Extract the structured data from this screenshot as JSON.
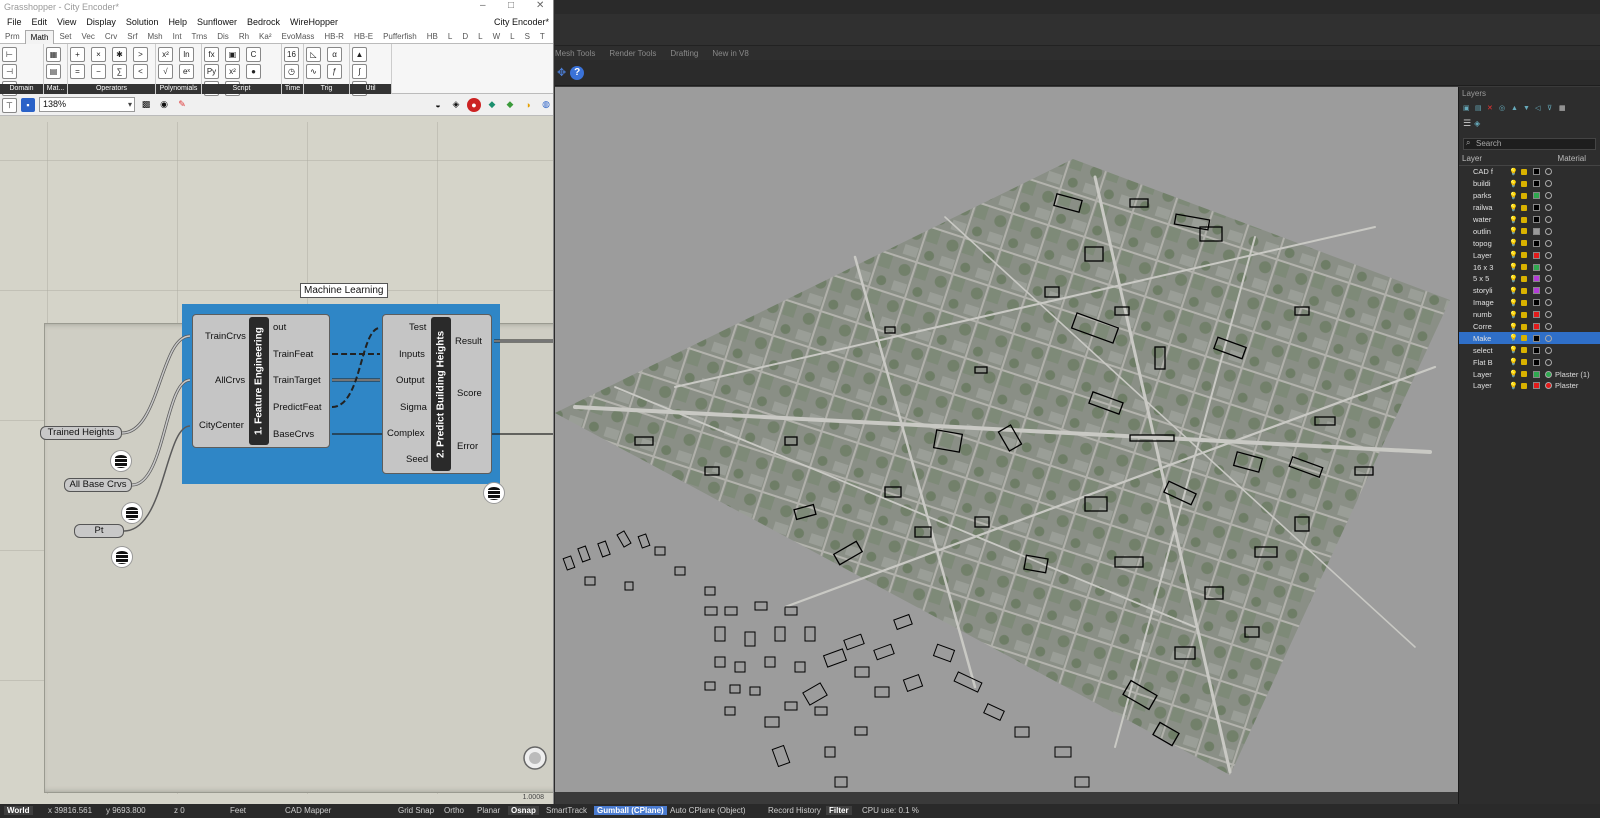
{
  "gh": {
    "title": "Grasshopper - City Encoder*",
    "doc_name": "City Encoder*",
    "menu": [
      "File",
      "Edit",
      "View",
      "Display",
      "Solution",
      "Help",
      "Sunflower",
      "Bedrock",
      "WireHopper"
    ],
    "tabs": [
      "Prm",
      "Math",
      "Set",
      "Vec",
      "Crv",
      "Srf",
      "Msh",
      "Int",
      "Trns",
      "Dis",
      "Rh",
      "Ka²",
      "EvoMass",
      "HB-R",
      "HB-E",
      "Pufferfish",
      "HB",
      "L",
      "D",
      "L",
      "W",
      "L",
      "S",
      "T"
    ],
    "active_tab": "Math",
    "ribbon_groups": [
      "Domain",
      "Mat...",
      "Operators",
      "Polynomials",
      "Script",
      "Time",
      "Trig",
      "Util"
    ],
    "zoom": "138%",
    "status_value": "1.0008",
    "group_title": "Machine Learning",
    "comp1": {
      "title": "1. Feature Engineering",
      "inputs": [
        "TrainCrvs",
        "AllCrvs",
        "CityCenter"
      ],
      "outputs": [
        "out",
        "TrainFeat",
        "TrainTarget",
        "PredictFeat",
        "BaseCrvs"
      ]
    },
    "comp2": {
      "title": "2. Predict Building Heights",
      "inputs": [
        "Test",
        "Inputs",
        "Output",
        "Sigma",
        "Complex",
        "Seed"
      ],
      "outputs": [
        "Result",
        "Score",
        "Error"
      ]
    },
    "params": [
      "Trained Heights",
      "All Base Crvs",
      "Pt"
    ]
  },
  "rhino": {
    "tabs": [
      "Mesh Tools",
      "Render Tools",
      "Drafting",
      "New in V8"
    ],
    "layers_title": "Layers",
    "search_placeholder": "Search",
    "col_layer": "Layer",
    "col_material": "Material",
    "layers": [
      {
        "name": "CAD f",
        "color": "#000000",
        "material": ""
      },
      {
        "name": "buildi",
        "color": "#000000",
        "material": ""
      },
      {
        "name": "parks",
        "color": "#2fa84f",
        "material": ""
      },
      {
        "name": "railwa",
        "color": "#000000",
        "material": ""
      },
      {
        "name": "water",
        "color": "#000000",
        "material": ""
      },
      {
        "name": "outlin",
        "color": "#9a9a9a",
        "material": ""
      },
      {
        "name": "topog",
        "color": "#000000",
        "material": ""
      },
      {
        "name": "Layer",
        "color": "#e21b1b",
        "material": ""
      },
      {
        "name": "16 x 3",
        "color": "#2fa84f",
        "material": ""
      },
      {
        "name": "5 x 5",
        "color": "#b43cd8",
        "material": ""
      },
      {
        "name": "storyli",
        "color": "#b43cd8",
        "material": ""
      },
      {
        "name": "Image",
        "color": "#000000",
        "material": ""
      },
      {
        "name": "numb",
        "color": "#e21b1b",
        "material": ""
      },
      {
        "name": "Corre",
        "color": "#e21b1b",
        "material": ""
      },
      {
        "name": "Make",
        "color": "#000000",
        "material": ""
      },
      {
        "name": "select",
        "color": "#000000",
        "material": ""
      },
      {
        "name": "Flat B",
        "color": "#000000",
        "material": ""
      },
      {
        "name": "Layer",
        "color": "#2fa84f",
        "material": "Plaster (1)"
      },
      {
        "name": "Layer",
        "color": "#e21b1b",
        "material": "Plaster"
      }
    ],
    "selected_layer_index": 14
  },
  "status": {
    "world": "World",
    "x": "x 39816.561",
    "y": "y 9693.800",
    "z": "z 0",
    "units": "Feet",
    "layer": "CAD Mapper",
    "grid_snap": "Grid Snap",
    "ortho": "Ortho",
    "planar": "Planar",
    "osnap": "Osnap",
    "smarttrack": "SmartTrack",
    "gumball": "Gumball (CPlane)",
    "auto_cplane": "Auto CPlane (Object)",
    "record_history": "Record History",
    "filter": "Filter",
    "cpu": "CPU use: 0.1 %"
  },
  "colors": {
    "ml_group": "#2f86c6",
    "canvas": "#d5d4c9",
    "selected_layer": "#2f6fc8"
  }
}
